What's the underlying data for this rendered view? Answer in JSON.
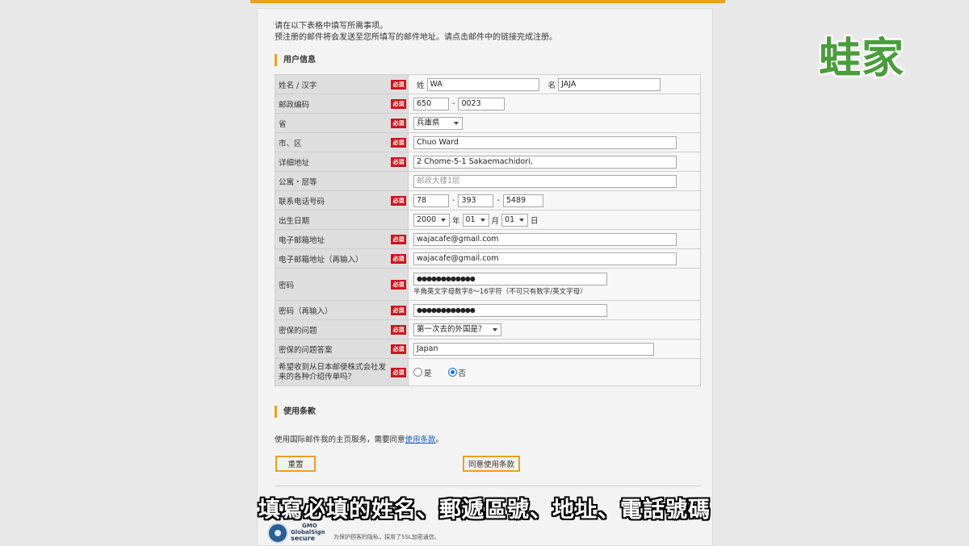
{
  "intro": {
    "line1": "请在以下表格中填写所需事项。",
    "line2": "预注册的邮件将会发送至您所填写的邮件地址。请点击邮件中的链接完成注册。"
  },
  "required_badge": "必須",
  "section_user": "用户信息",
  "fields": {
    "name": {
      "label": "姓名 / 汉字",
      "last_prefix": "姓",
      "last_value": "WA",
      "first_prefix": "名",
      "first_value": "JAJA"
    },
    "postal": {
      "label": "邮政编码",
      "part1": "650",
      "part2": "0023",
      "sep": "-"
    },
    "prefecture": {
      "label": "省",
      "value": "兵庫県"
    },
    "city": {
      "label": "市、区",
      "value": "Chuo Ward"
    },
    "address": {
      "label": "详细地址",
      "value": "2 Chome-5-1 Sakaemachidori,"
    },
    "building": {
      "label": "公寓・层等",
      "placeholder": "邮政大楼1层"
    },
    "phone": {
      "label": "联系电话号码",
      "part1": "78",
      "part2": "393",
      "part3": "5489",
      "sep": "-"
    },
    "birth": {
      "label": "出生日期",
      "year": "2000",
      "year_unit": "年",
      "month": "01",
      "month_unit": "月",
      "day": "01",
      "day_unit": "日"
    },
    "email": {
      "label": "电子邮箱地址",
      "value": "wajacafe@gmail.com"
    },
    "email_confirm": {
      "label": "电子邮箱地址（再输入）",
      "value": "wajacafe@gmail.com"
    },
    "password": {
      "label": "密码",
      "value": "●●●●●●●●●●●●",
      "hint": "半角英文字母数字8～16字符（不可只有数字/英文字母）"
    },
    "password_confirm": {
      "label": "密码（再输入）",
      "value": "●●●●●●●●●●●●"
    },
    "security_q": {
      "label": "密保的问题",
      "value": "第一次去的外国是？"
    },
    "security_a": {
      "label": "密保的问题答案",
      "value": "Japan"
    },
    "newsletter": {
      "label": "希望收到从日本邮便株式会社发来的各种介绍传单吗？",
      "yes": "是",
      "no": "否",
      "selected": "no"
    }
  },
  "section_terms": "使用条款",
  "terms": {
    "text": "使用国际邮件我的主页服务，需要同意",
    "link": "使用条款",
    "end": "。"
  },
  "buttons": {
    "reset": "重置",
    "agree": "同意使用条款"
  },
  "seal": {
    "line1": "GMO",
    "line2": "GlobalSign",
    "line3": "secure",
    "note": "为保护顾客的隐私，採用了SSL加密通信。"
  },
  "logo": "蛙家",
  "subtitle": "填寫必填的姓名、郵遞區號、地址、電話號碼",
  "colors": {
    "accent": "#e8a21c",
    "required": "#c8161d",
    "logo": "#4a9c3c",
    "link": "#1a5fb4"
  }
}
